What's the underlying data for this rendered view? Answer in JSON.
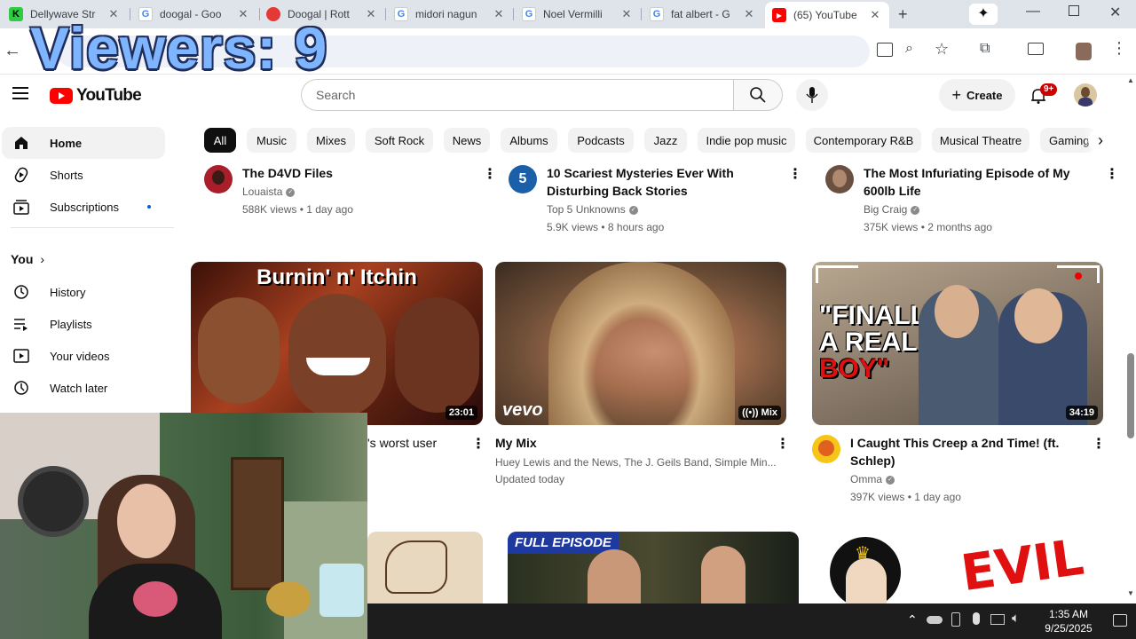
{
  "overlay": {
    "viewers": "Viewers: 9"
  },
  "tabs": [
    {
      "title": "Dellywave Str",
      "favicon": "K",
      "color": "#2ecc40",
      "fg": "#000"
    },
    {
      "title": "doogal - Goo",
      "favicon": "G",
      "color": "#4285f4",
      "fg": "#fff"
    },
    {
      "title": "Doogal | Rott",
      "favicon": "●",
      "color": "#e53935",
      "fg": "#fff"
    },
    {
      "title": "midori nagun",
      "favicon": "G",
      "color": "#4285f4",
      "fg": "#fff"
    },
    {
      "title": "Noel Vermilli",
      "favicon": "G",
      "color": "#4285f4",
      "fg": "#fff"
    },
    {
      "title": "fat albert - G",
      "favicon": "G",
      "color": "#4285f4",
      "fg": "#fff"
    },
    {
      "title": "(65) YouTube",
      "favicon": "▶",
      "color": "#ff0000",
      "fg": "#fff"
    }
  ],
  "header": {
    "logo_text": "YouTube",
    "search_placeholder": "Search",
    "create_label": "Create",
    "notif_badge": "9+"
  },
  "chips": [
    "All",
    "Music",
    "Mixes",
    "Soft Rock",
    "News",
    "Albums",
    "Podcasts",
    "Jazz",
    "Indie pop music",
    "Contemporary R&B",
    "Musical Theatre",
    "Gaming"
  ],
  "sidebar": {
    "home": "Home",
    "shorts": "Shorts",
    "subscriptions": "Subscriptions",
    "you": "You",
    "history": "History",
    "playlists": "Playlists",
    "your_videos": "Your videos",
    "watch_later": "Watch later"
  },
  "row1": [
    {
      "title": "The D4VD Files",
      "channel": "Louaista",
      "stats": "588K views • 1 day ago"
    },
    {
      "title": "10 Scariest Mysteries Ever With Disturbing Back Stories",
      "channel": "Top 5 Unknowns",
      "stats": "5.9K views • 8 hours ago"
    },
    {
      "title": "The Most Infuriating Episode of My 600lb Life",
      "channel": "Big Craig",
      "stats": "375K views • 2 months ago"
    }
  ],
  "row2": [
    {
      "title": "'s worst user",
      "thumb_text": "Burnin' n' Itchin",
      "duration": "23:01"
    },
    {
      "title": "My Mix",
      "channel": "Huey Lewis and the News, The J. Geils Band, Simple Min...",
      "stats": "Updated today",
      "thumb_text": "vevo",
      "badge": "Mix"
    },
    {
      "title": "I Caught This Creep a 2nd Time! (ft. Schlep)",
      "channel": "Omma",
      "stats": "397K views • 1 day ago",
      "thumb_text_1": "\"FINALLY",
      "thumb_text_2": "A REAL",
      "thumb_text_3": "BOY\"",
      "duration": "34:19"
    }
  ],
  "row3": [
    {
      "thumb_text": "FULL EPISODE"
    },
    {
      "thumb_text": "EVIL"
    }
  ],
  "taskbar": {
    "time": "1:35 AM",
    "date": "9/25/2025"
  }
}
